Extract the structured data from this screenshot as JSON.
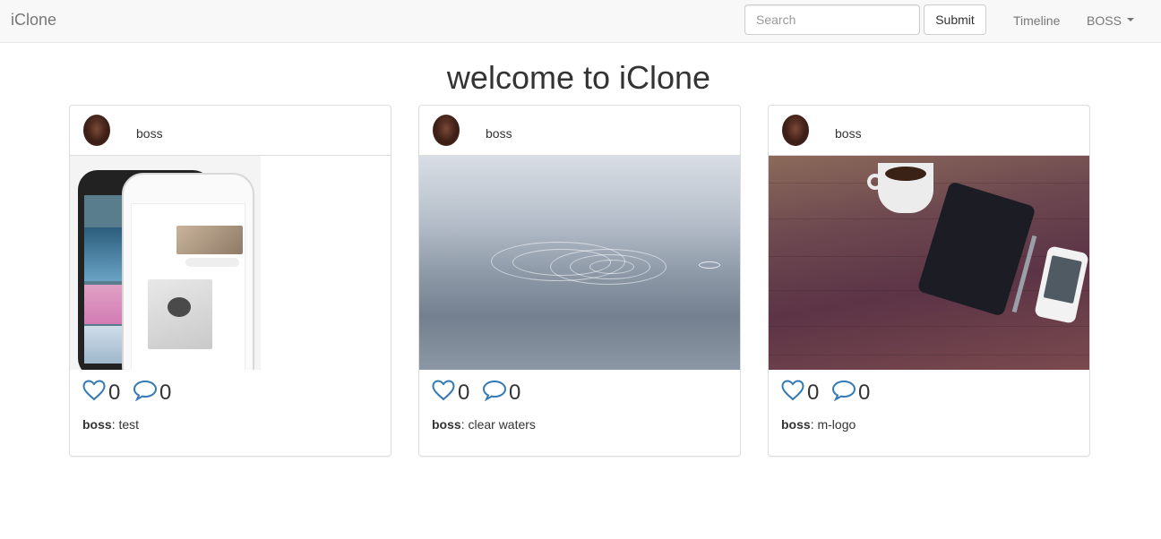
{
  "navbar": {
    "brand": "iClone",
    "search_placeholder": "Search",
    "submit_label": "Submit",
    "timeline_label": "Timeline",
    "user_menu_label": "BOSS"
  },
  "page": {
    "title": "welcome to iClone"
  },
  "posts": [
    {
      "author": "boss",
      "likes": "0",
      "comments": "0",
      "caption_author": "boss",
      "caption_text": ": test"
    },
    {
      "author": "boss",
      "likes": "0",
      "comments": "0",
      "caption_author": "boss",
      "caption_text": ": clear waters"
    },
    {
      "author": "boss",
      "likes": "0",
      "comments": "0",
      "caption_author": "boss",
      "caption_text": ": m-logo"
    }
  ],
  "icons": {
    "like": "heart-outline-icon",
    "comment": "speech-bubble-outline-icon"
  },
  "colors": {
    "icon_blue": "#337ab7",
    "navbar_bg": "#f8f8f8"
  }
}
